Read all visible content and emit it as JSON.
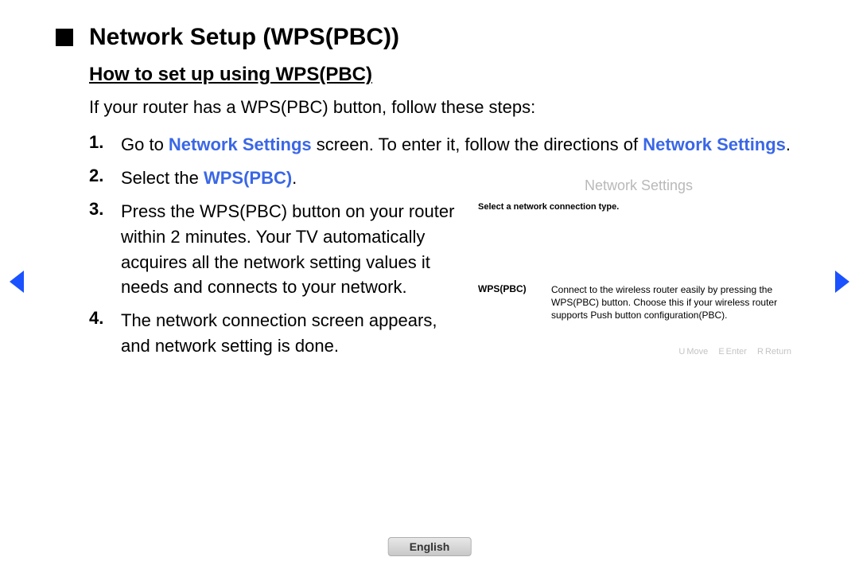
{
  "title": "Network Setup (WPS(PBC))",
  "subtitle": "How to set up using WPS(PBC)",
  "intro": "If your router has a WPS(PBC) button, follow these steps:",
  "steps": {
    "s1_num": "1.",
    "s1_a": "Go to ",
    "s1_b": "Network Settings",
    "s1_c": " screen. To enter it, follow the directions of ",
    "s1_d": "Network Settings",
    "s1_e": ".",
    "s2_num": "2.",
    "s2_a": "Select the ",
    "s2_b": "WPS(PBC)",
    "s2_c": ".",
    "s3_num": "3.",
    "s3": "Press the WPS(PBC) button on your router within 2 minutes. Your TV automatically acquires all the network setting values it needs and connects to your network.",
    "s4_num": "4.",
    "s4": "The network connection screen appears, and network setting is done."
  },
  "inset": {
    "title": "Network Settings",
    "subtitle": "Select a network connection type.",
    "item_label": "WPS(PBC)",
    "item_desc": "Connect to the wireless router easily by pressing the WPS(PBC) button. Choose this if your wireless router supports Push button configuration(PBC).",
    "footer_u_key": "U",
    "footer_u": "Move",
    "footer_e_key": "E",
    "footer_e": "Enter",
    "footer_r_key": "R",
    "footer_r": "Return"
  },
  "language": "English"
}
